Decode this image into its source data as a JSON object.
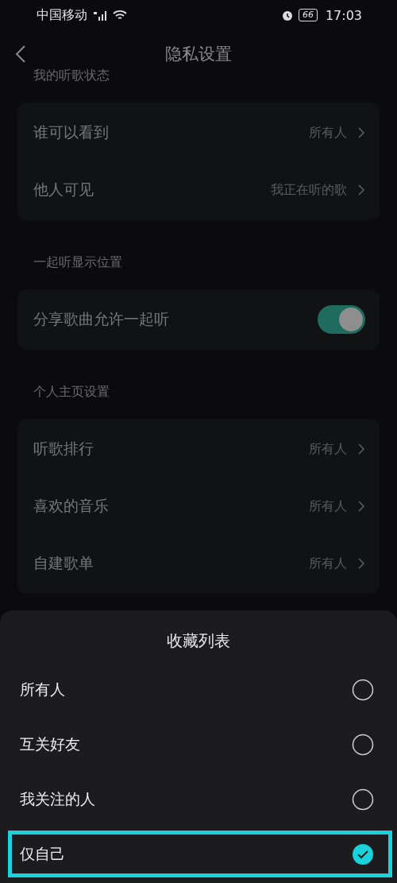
{
  "status_bar": {
    "carrier": "中国移动",
    "battery": "66",
    "time": "17:03"
  },
  "header": {
    "title": "隐私设置"
  },
  "sections": [
    {
      "title": "我的听歌状态",
      "rows": [
        {
          "kind": "link",
          "label": "谁可以看到",
          "value": "所有人"
        },
        {
          "kind": "link",
          "label": "他人可见",
          "value": "我正在听的歌"
        }
      ]
    },
    {
      "title": "一起听显示位置",
      "rows": [
        {
          "kind": "toggle",
          "label": "分享歌曲允许一起听",
          "on": true
        }
      ]
    },
    {
      "title": "个人主页设置",
      "rows": [
        {
          "kind": "link",
          "label": "听歌排行",
          "value": "所有人"
        },
        {
          "kind": "link",
          "label": "喜欢的音乐",
          "value": "所有人"
        },
        {
          "kind": "link",
          "label": "自建歌单",
          "value": "所有人"
        }
      ]
    }
  ],
  "sheet": {
    "title": "收藏列表",
    "options": [
      {
        "label": "所有人",
        "selected": false,
        "highlighted": false
      },
      {
        "label": "互关好友",
        "selected": false,
        "highlighted": false
      },
      {
        "label": "我关注的人",
        "selected": false,
        "highlighted": false
      },
      {
        "label": "仅自己",
        "selected": true,
        "highlighted": true
      }
    ]
  }
}
